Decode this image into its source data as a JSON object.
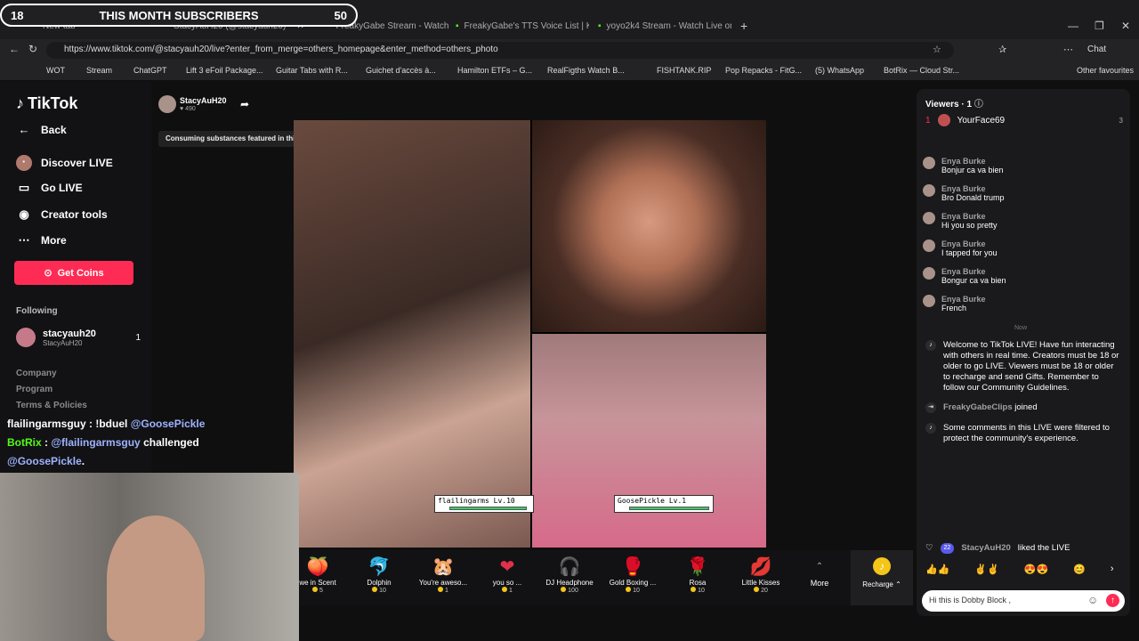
{
  "overlay": {
    "subs_left": "18",
    "subs_title": "THIS MONTH SUBSCRIBERS",
    "subs_right": "50"
  },
  "tabs": [
    {
      "label": "New tab"
    },
    {
      "label": "StacyAuH20 (@stacyauh20)"
    },
    {
      "label": "FreakyGabe Stream - Watch L"
    },
    {
      "label": "FreakyGabe's TTS Voice List | Kick"
    },
    {
      "label": "yoyo2k4 Stream - Watch Live on K"
    }
  ],
  "address": {
    "url": "https://www.tiktok.com/@stacyauh20/live?enter_from_merge=others_homepage&enter_method=others_photo",
    "chat_label": "Chat"
  },
  "bookmarks": [
    "WOT",
    "Stream",
    "ChatGPT",
    "Lift 3 eFoil Package...",
    "Guitar Tabs with R...",
    "Guichet d'accès à...",
    "Hamilton ETFs – G...",
    "RealFigths Watch B...",
    "FISHTANK.RIP",
    "Pop Repacks - FitG...",
    "(5) WhatsApp",
    "BotRix — Cloud Str...",
    "Other favourites"
  ],
  "sidebar": {
    "brand": "TikTok",
    "back": "Back",
    "nav": [
      {
        "label": "Discover LIVE",
        "icon": "discover-icon"
      },
      {
        "label": "Go LIVE",
        "icon": "camera-icon"
      },
      {
        "label": "Creator tools",
        "icon": "lightbulb-icon"
      },
      {
        "label": "More",
        "icon": "more-icon"
      }
    ],
    "coins": "Get Coins",
    "following_title": "Following",
    "following": {
      "name": "stacyauh20",
      "handle": "StacyAuH20",
      "count": "1"
    },
    "links": [
      "Company",
      "Program",
      "Terms & Policies"
    ]
  },
  "stream": {
    "host": "StacyAuH20",
    "likes": "490",
    "warning": "Consuming substances featured in this LIVE could ha...",
    "battle": [
      {
        "name": "flailingarms",
        "level": "Lv.10",
        "hp": 0.95
      },
      {
        "name": "GoosePickle",
        "level": "Lv.1",
        "hp": 0.98
      }
    ]
  },
  "chat_overlay": [
    {
      "user": "flailingarmsguy",
      "text": " : !bduel ",
      "mention": "@GoosePickle"
    },
    {
      "user": "BotRix",
      "text": " : ",
      "mention": "@flailingarmsguy",
      "text2": " challenged",
      "mention2": "@GoosePickle",
      "tail": "."
    }
  ],
  "gifts": [
    {
      "name": "we in Scent",
      "price": "5",
      "icon": "perfume-icon",
      "glyph": "🍑"
    },
    {
      "name": "Dolphin",
      "price": "10",
      "icon": "dolphin-icon",
      "glyph": "🐬"
    },
    {
      "name": "You're aweso...",
      "price": "1",
      "icon": "hamster-icon",
      "glyph": "🐹"
    },
    {
      "name": "you so ...",
      "price": "1",
      "icon": "heart-icon",
      "glyph": "❤"
    },
    {
      "name": "DJ Headphone",
      "price": "100",
      "icon": "headphone-icon",
      "glyph": "🎧"
    },
    {
      "name": "Gold Boxing ...",
      "price": "10",
      "icon": "glove-icon",
      "glyph": "🥊"
    },
    {
      "name": "Rosa",
      "price": "10",
      "icon": "rose-icon",
      "glyph": "🌹"
    },
    {
      "name": "Little Kisses",
      "price": "20",
      "icon": "kisses-icon",
      "glyph": "💋"
    }
  ],
  "gift_more": "More",
  "recharge": "Recharge",
  "viewers": {
    "title": "Viewers · 1",
    "rank": "1",
    "name": "YourFace69",
    "count": "3"
  },
  "comments": [
    {
      "user": "Enya Burke",
      "text": "Bonjur ca va bien"
    },
    {
      "user": "Enya Burke",
      "text": "Bro Donald trump"
    },
    {
      "user": "Enya Burke",
      "text": "Hi you so pretty"
    },
    {
      "user": "Enya Burke",
      "text": "I tapped for you"
    },
    {
      "user": "Enya Burke",
      "text": "Bongur ca va bien"
    },
    {
      "user": "Enya Burke",
      "text": "French"
    }
  ],
  "now_label": "Now",
  "welcome": "Welcome to TikTok LIVE! Have fun interacting with others in real time. Creators must be 18 or older to go LIVE. Viewers must be 18 or older to recharge and send Gifts. Remember to follow our Community Guidelines.",
  "joined": {
    "user": "FreakyGabeClips",
    "text": "joined"
  },
  "filtered": "Some comments in this LIVE were filtered to protect the community's experience.",
  "liked": {
    "level": "22",
    "user": "StacyAuH20",
    "text": "liked the LIVE"
  },
  "input_value": "Hi this is Dobby Block ,",
  "colors": {
    "accent": "#fe2c55",
    "coin": "#f5c518"
  }
}
